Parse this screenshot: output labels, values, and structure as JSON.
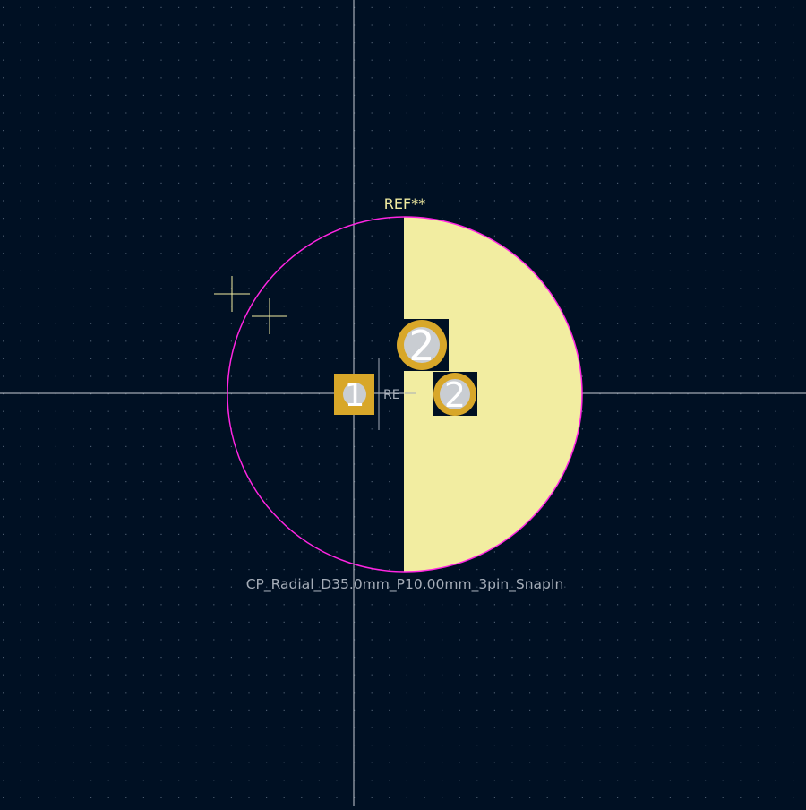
{
  "footprint": {
    "reference": "REF**",
    "value": "CP_Radial_D35.0mm_P10.00mm_3pin_SnapIn",
    "fab_reference": "RE"
  },
  "pads": [
    {
      "number": "1",
      "shape": "rect"
    },
    {
      "number": "2",
      "shape": "circle"
    },
    {
      "number": "2",
      "shape": "circle"
    }
  ],
  "colors": {
    "background": "#001023",
    "grid_dots": "#4a5a6e",
    "crosshair": "#c8cdd4",
    "silkscreen_fill": "#f2eda1",
    "silkscreen_text": "#f2eda1",
    "courtyard": "#ff26e2",
    "pad": "#d8a729",
    "drill_hole": "#c9cdd2",
    "value_text": "#a5adb8",
    "pad_number_text": "#ffffff"
  }
}
